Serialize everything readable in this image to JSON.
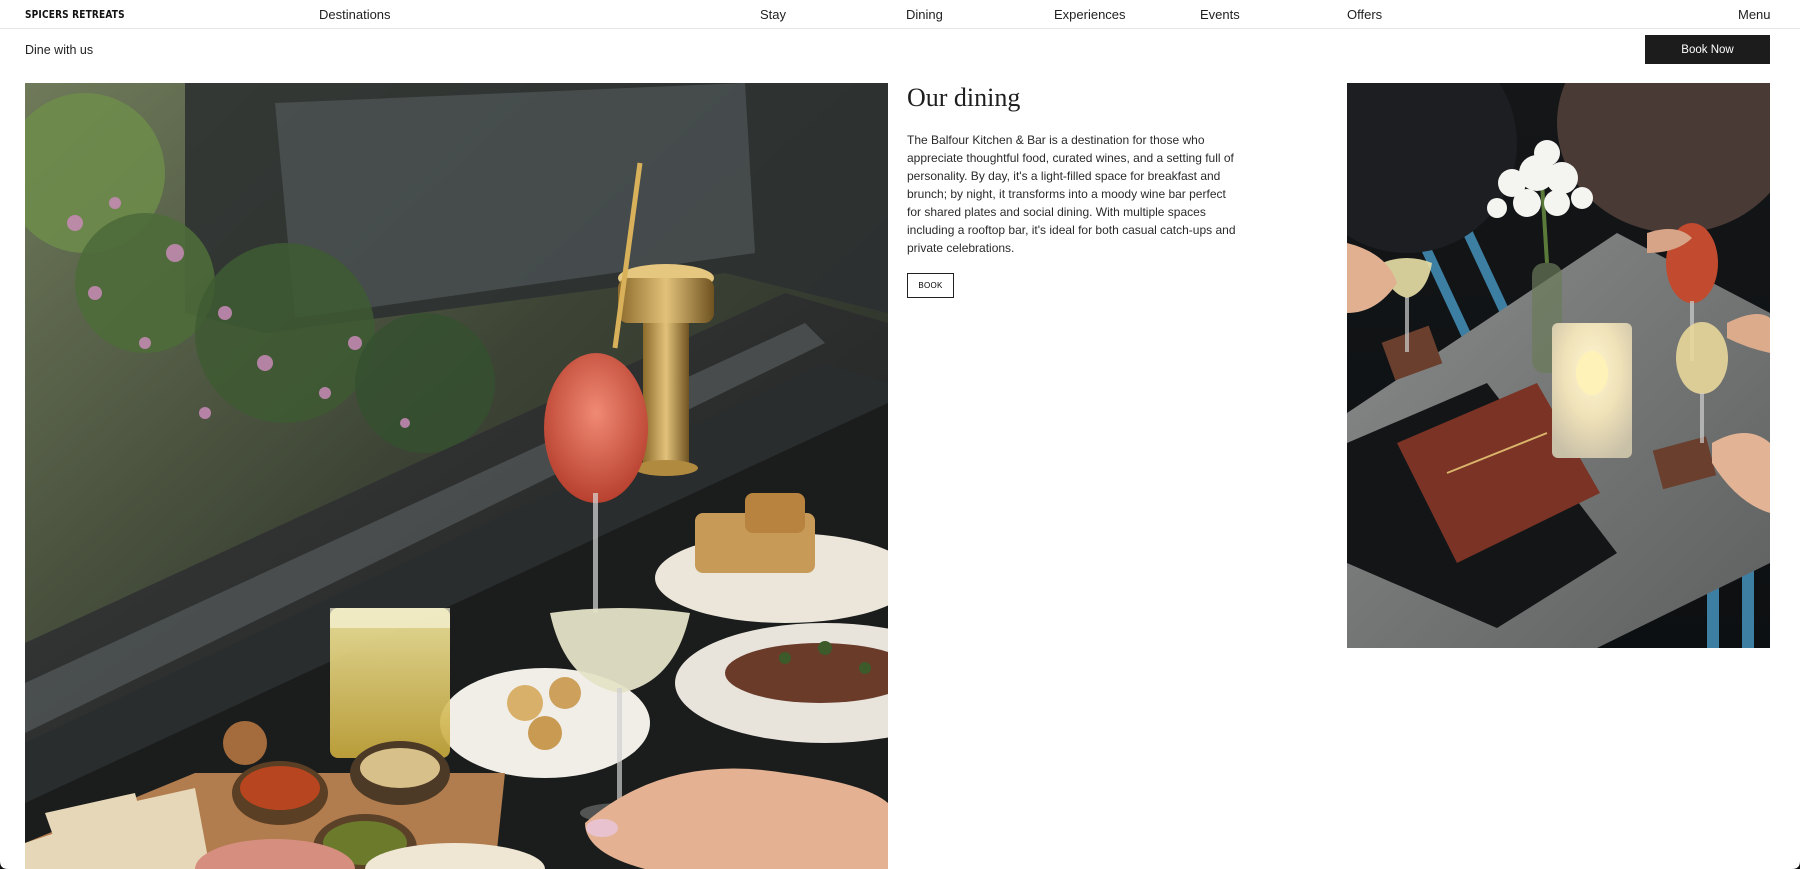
{
  "header": {
    "brand": "SPICERS RETREATS",
    "nav": {
      "destinations": "Destinations",
      "stay": "Stay",
      "dining": "Dining",
      "experiences": "Experiences",
      "events": "Events",
      "offers": "Offers",
      "menu": "Menu"
    }
  },
  "subbar": {
    "title": "Dine with us",
    "book_now": "Book Now"
  },
  "dining": {
    "heading": "Our dining",
    "body": "The Balfour Kitchen & Bar is a destination for those who appreciate thoughtful food, curated wines, and a setting full of personality. By day, it's a light-filled space for breakfast and brunch; by night, it transforms into a moody wine bar perfect for shared plates and social dining. With multiple spaces including a rooftop bar, it's ideal for both casual catch-ups and private celebrations.",
    "book": "BOOK"
  },
  "colors": {
    "button_dark": "#1c1c1c",
    "text": "#1b1b1b"
  }
}
